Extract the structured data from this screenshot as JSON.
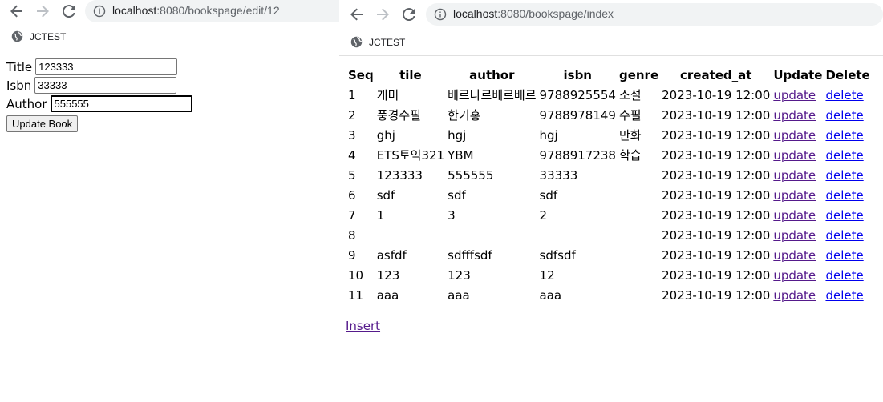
{
  "left": {
    "url_host": "localhost",
    "url_path": ":8080/bookspage/edit/12",
    "bookmark": "JCTEST",
    "form": {
      "title_label": "Title",
      "title_value": "123333",
      "isbn_label": "Isbn",
      "isbn_value": "33333",
      "author_label": "Author",
      "author_value": "555555",
      "submit_label": "Update Book"
    }
  },
  "right": {
    "url_host": "localhost",
    "url_path": ":8080/bookspage/index",
    "bookmark": "JCTEST",
    "headers": [
      "Seq",
      "tile",
      "author",
      "isbn",
      "genre",
      "created_at",
      "Update",
      "Delete"
    ],
    "rows": [
      {
        "seq": "1",
        "tile": "개미",
        "author": "베르나르베르베르",
        "isbn": "9788925554",
        "genre": "소설",
        "created_at": "2023-10-19 12:00",
        "update": "update",
        "delete": "delete"
      },
      {
        "seq": "2",
        "tile": "풍경수필",
        "author": "한기홍",
        "isbn": "9788978149",
        "genre": "수필",
        "created_at": "2023-10-19 12:00",
        "update": "update",
        "delete": "delete"
      },
      {
        "seq": "3",
        "tile": "ghj",
        "author": "hgj",
        "isbn": "hgj",
        "genre": "만화",
        "created_at": "2023-10-19 12:00",
        "update": "update",
        "delete": "delete"
      },
      {
        "seq": "4",
        "tile": "ETS토익321",
        "author": "YBM",
        "isbn": "9788917238",
        "genre": "학습",
        "created_at": "2023-10-19 12:00",
        "update": "update",
        "delete": "delete"
      },
      {
        "seq": "5",
        "tile": "123333",
        "author": "555555",
        "isbn": "33333",
        "genre": "",
        "created_at": "2023-10-19 12:00",
        "update": "update",
        "delete": "delete"
      },
      {
        "seq": "6",
        "tile": "sdf",
        "author": "sdf",
        "isbn": "sdf",
        "genre": "",
        "created_at": "2023-10-19 12:00",
        "update": "update",
        "delete": "delete"
      },
      {
        "seq": "7",
        "tile": "1",
        "author": "3",
        "isbn": "2",
        "genre": "",
        "created_at": "2023-10-19 12:00",
        "update": "update",
        "delete": "delete"
      },
      {
        "seq": "8",
        "tile": "",
        "author": "",
        "isbn": "",
        "genre": "",
        "created_at": "2023-10-19 12:00",
        "update": "update",
        "delete": "delete"
      },
      {
        "seq": "9",
        "tile": "asfdf",
        "author": "sdfffsdf",
        "isbn": "sdfsdf",
        "genre": "",
        "created_at": "2023-10-19 12:00",
        "update": "update",
        "delete": "delete"
      },
      {
        "seq": "10",
        "tile": "123",
        "author": "123",
        "isbn": "12",
        "genre": "",
        "created_at": "2023-10-19 12:00",
        "update": "update",
        "delete": "delete"
      },
      {
        "seq": "11",
        "tile": "aaa",
        "author": "aaa",
        "isbn": "aaa",
        "genre": "",
        "created_at": "2023-10-19 12:00",
        "update": "update",
        "delete": "delete"
      }
    ],
    "insert_label": "Insert"
  },
  "colors": {
    "link": "#0000ee",
    "visited_link": "#551a8b",
    "urlbar_bg": "#f1f3f4",
    "icon_gray": "#5f6368"
  }
}
